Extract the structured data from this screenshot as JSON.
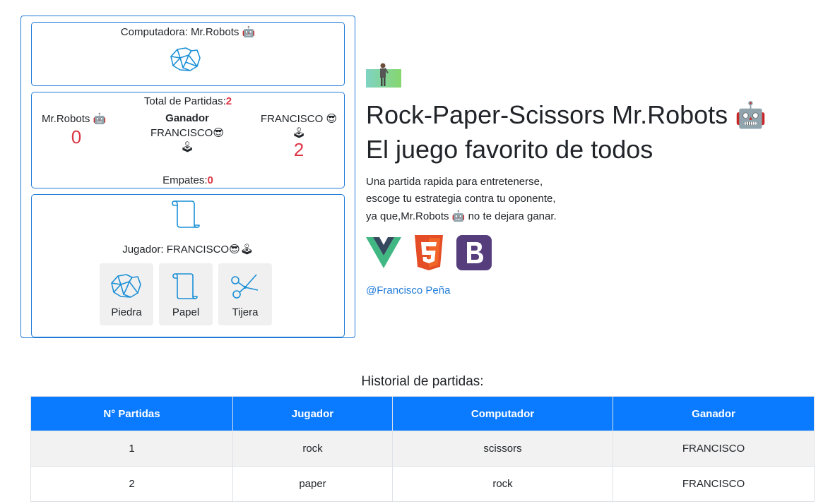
{
  "computer_card": {
    "label": "Computadora: Mr.Robots",
    "robot_emoji": "🤖",
    "choice_icon": "rock-icon"
  },
  "score": {
    "total_label": "Total de Partidas:",
    "total_value": "2",
    "computer_name": "Mr.Robots",
    "computer_emoji": "🤖",
    "computer_score": "0",
    "winner_heading": "Ganador",
    "winner_name": "FRANCISCO",
    "winner_emoji": "😎",
    "winner_joystick": "🕹",
    "player_name": "FRANCISCO",
    "player_emoji": "😎",
    "player_joystick": "🕹",
    "player_score": "2",
    "draws_label": "Empates:",
    "draws_value": "0"
  },
  "player_card": {
    "choice_icon": "paper-icon",
    "label": "Jugador: FRANCISCO",
    "emoji": "😎",
    "joystick": "🕹",
    "choices": [
      {
        "label": "Piedra",
        "icon": "rock-icon"
      },
      {
        "label": "Papel",
        "icon": "paper-icon"
      },
      {
        "label": "Tijera",
        "icon": "scissors-icon"
      }
    ]
  },
  "hero": {
    "title_line1": "Rock-Paper-Scissors Mr.Robots",
    "title_emoji": "🤖",
    "title_line2": "El juego favorito de todos",
    "desc_line1": "Una partida rapida para entretenerse,",
    "desc_line2": "escoge tu estrategia contra tu oponente,",
    "desc_line3_pre": "ya que,Mr.Robots",
    "desc_line3_emoji": "🤖",
    "desc_line3_post": " no te dejara ganar.",
    "logos": [
      "vue-logo",
      "html5-logo",
      "bootstrap-logo"
    ],
    "author": "@Francisco Peña"
  },
  "history": {
    "title": "Historial de partidas:",
    "columns": [
      "N° Partidas",
      "Jugador",
      "Computador",
      "Ganador"
    ],
    "rows": [
      [
        "1",
        "rock",
        "scissors",
        "FRANCISCO"
      ],
      [
        "2",
        "paper",
        "rock",
        "FRANCISCO"
      ]
    ]
  },
  "colors": {
    "accent": "#1f7bd8",
    "table_header": "#0a7bff",
    "score_red": "#dc3545"
  }
}
